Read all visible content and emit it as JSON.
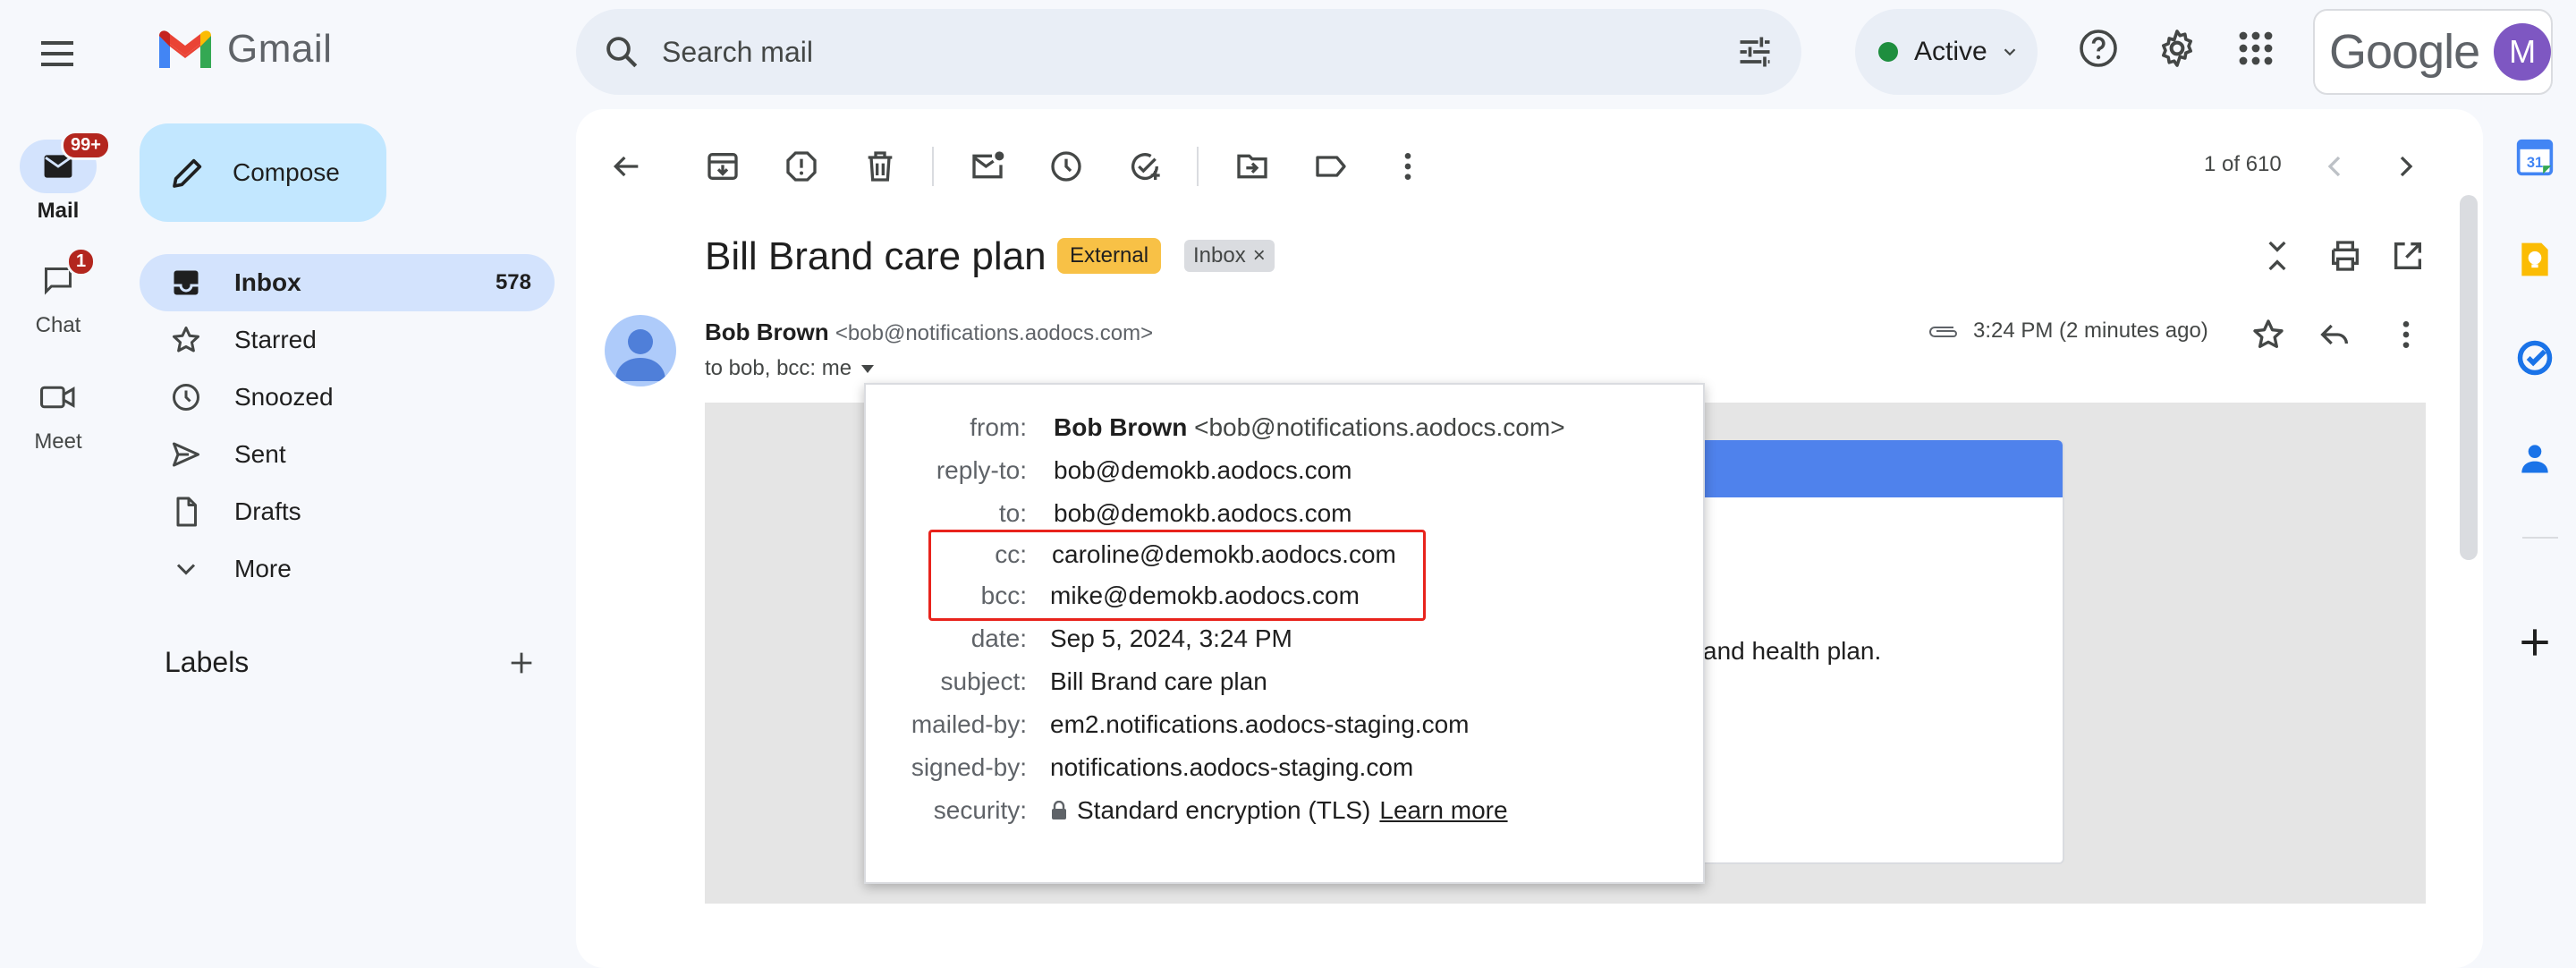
{
  "app": {
    "name": "Gmail",
    "google_word": "Google",
    "avatar_letter": "M"
  },
  "rail": [
    {
      "label": "Mail",
      "badge": "99+"
    },
    {
      "label": "Chat",
      "badge": "1"
    },
    {
      "label": "Meet",
      "badge": ""
    }
  ],
  "compose": {
    "label": "Compose"
  },
  "nav": [
    {
      "label": "Inbox",
      "count": "578",
      "icon": "inbox-icon"
    },
    {
      "label": "Starred",
      "count": "",
      "icon": "star-icon"
    },
    {
      "label": "Snoozed",
      "count": "",
      "icon": "clock-icon"
    },
    {
      "label": "Sent",
      "count": "",
      "icon": "send-icon"
    },
    {
      "label": "Drafts",
      "count": "",
      "icon": "draft-icon"
    },
    {
      "label": "More",
      "count": "",
      "icon": "chevron-down-icon"
    }
  ],
  "labels": {
    "title": "Labels"
  },
  "search": {
    "placeholder": "Search mail"
  },
  "status": {
    "label": "Active",
    "color": "#1e8e3e"
  },
  "toolbar": {
    "pager": "1 of 610"
  },
  "email": {
    "subject": "Bill Brand care plan",
    "tag_external": "External",
    "tag_inbox": "Inbox",
    "tag_inbox_close": "×",
    "sender_name": "Bob Brown",
    "sender_email": "<bob@notifications.aodocs.com>",
    "to_line": "to bob, bcc: me",
    "time": "3:24 PM (2 minutes ago)",
    "body_snippet": "and health plan."
  },
  "details": [
    {
      "label": "from:",
      "value": "Bob Brown",
      "extra": "<bob@notifications.aodocs.com>"
    },
    {
      "label": "reply-to:",
      "value": "bob@demokb.aodocs.com"
    },
    {
      "label": "to:",
      "value": "bob@demokb.aodocs.com"
    },
    {
      "label": "cc:",
      "value": "caroline@demokb.aodocs.com"
    },
    {
      "label": "bcc:",
      "value": "mike@demokb.aodocs.com"
    },
    {
      "label": "date:",
      "value": "Sep 5, 2024, 3:24 PM"
    },
    {
      "label": "subject:",
      "value": "Bill Brand care plan"
    },
    {
      "label": "mailed-by:",
      "value": "em2.notifications.aodocs-staging.com"
    },
    {
      "label": "signed-by:",
      "value": "notifications.aodocs-staging.com"
    },
    {
      "label": "security:",
      "value": "Standard encryption (TLS)",
      "link": "Learn more"
    }
  ],
  "colors": {
    "accent": "#0b57d0",
    "highlight": "#e8231c",
    "external_tag": "#f8c146",
    "inner_header": "#4f82ec"
  }
}
